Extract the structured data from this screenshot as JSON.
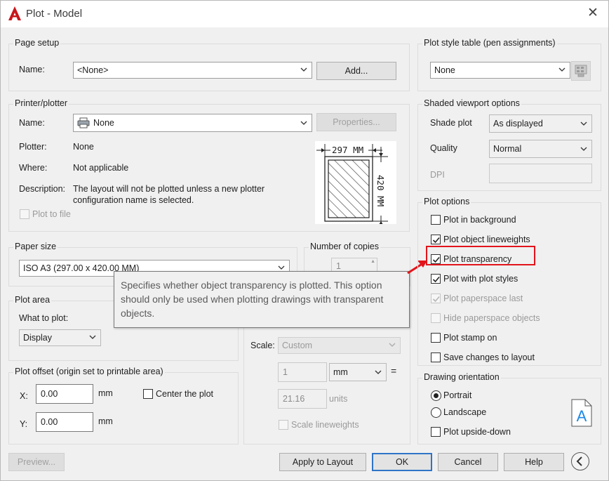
{
  "window": {
    "title": "Plot - Model"
  },
  "page_setup": {
    "title": "Page setup",
    "name_label": "Name:",
    "name_value": "<None>",
    "add_button": "Add..."
  },
  "printer": {
    "title": "Printer/plotter",
    "name_label": "Name:",
    "name_value": "None",
    "properties_button": "Properties...",
    "plotter_label": "Plotter:",
    "plotter_value": "None",
    "where_label": "Where:",
    "where_value": "Not applicable",
    "description_label": "Description:",
    "description_line1": "The layout will not be plotted unless a new plotter",
    "description_line2": "configuration name is selected.",
    "plot_to_file": "Plot to file",
    "preview_width": "297 MM",
    "preview_height": "420 MM"
  },
  "paper_size": {
    "title": "Paper size",
    "value": "ISO A3 (297.00 x 420.00 MM)"
  },
  "copies": {
    "title": "Number of copies",
    "value": "1"
  },
  "plot_area": {
    "title": "Plot area",
    "what_label": "What to plot:",
    "what_value": "Display"
  },
  "plot_offset": {
    "title": "Plot offset (origin set to printable area)",
    "x_label": "X:",
    "x_value": "0.00",
    "x_unit": "mm",
    "y_label": "Y:",
    "y_value": "0.00",
    "y_unit": "mm",
    "center_label": "Center the plot"
  },
  "plot_scale": {
    "scale_label": "Scale:",
    "scale_value": "Custom",
    "value1": "1",
    "unit_value": "mm",
    "equals": "=",
    "value2": "21.16",
    "units_label": "units",
    "lineweights_label": "Scale lineweights"
  },
  "tooltip": {
    "line1": "Specifies whether object transparency is plotted. This option",
    "line2": "should only be used when plotting drawings with transparent",
    "line3": "objects."
  },
  "plot_style": {
    "title": "Plot style table (pen assignments)",
    "value": "None"
  },
  "shaded": {
    "title": "Shaded viewport options",
    "shade_label": "Shade plot",
    "shade_value": "As displayed",
    "quality_label": "Quality",
    "quality_value": "Normal",
    "dpi_label": "DPI"
  },
  "plot_options": {
    "title": "Plot options",
    "items": [
      {
        "label": "Plot in background",
        "checked": false,
        "enabled": true
      },
      {
        "label": "Plot object lineweights",
        "checked": true,
        "enabled": true
      },
      {
        "label": "Plot transparency",
        "checked": true,
        "enabled": true
      },
      {
        "label": "Plot with plot styles",
        "checked": true,
        "enabled": true
      },
      {
        "label": "Plot paperspace last",
        "checked": true,
        "enabled": false
      },
      {
        "label": "Hide paperspace objects",
        "checked": false,
        "enabled": false
      },
      {
        "label": "Plot stamp on",
        "checked": false,
        "enabled": true
      },
      {
        "label": "Save changes to layout",
        "checked": false,
        "enabled": true
      }
    ]
  },
  "orientation": {
    "title": "Drawing orientation",
    "portrait": "Portrait",
    "landscape": "Landscape",
    "upside_down": "Plot upside-down",
    "selected": "Portrait"
  },
  "footer": {
    "preview": "Preview...",
    "apply": "Apply to Layout",
    "ok": "OK",
    "cancel": "Cancel",
    "help": "Help"
  },
  "colors": {
    "accent": "#e2141b",
    "logo": "#c8161d",
    "orientation_icon": "#1e88e5"
  }
}
